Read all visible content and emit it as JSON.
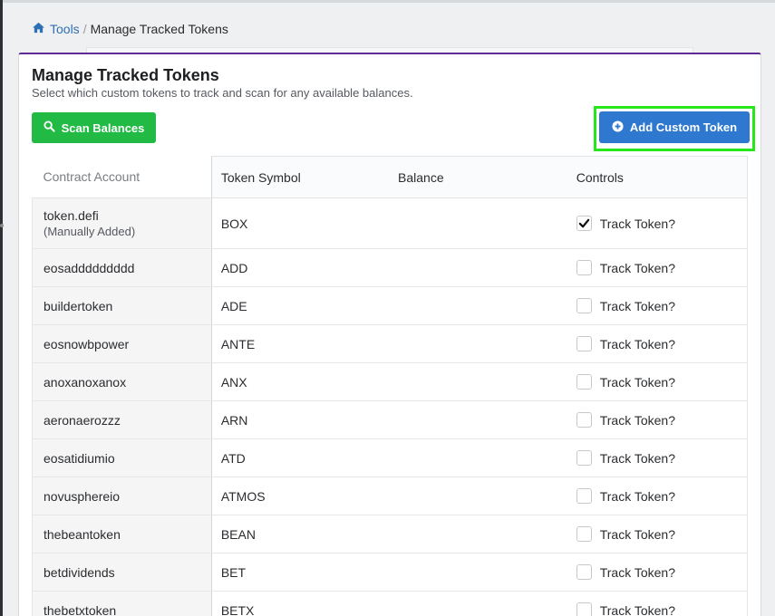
{
  "breadcrumb": {
    "parent": "Tools",
    "separator": "/",
    "current": "Manage Tracked Tokens",
    "link_color": "#2f6fb4"
  },
  "card": {
    "title": "Manage Tracked Tokens",
    "subtitle": "Select which custom tokens to track and scan for any available balances.",
    "accent_color": "#5e2b97"
  },
  "actions": {
    "scan_label": "Scan Balances",
    "scan_color": "#21ba45",
    "add_label": "Add Custom Token",
    "add_color": "#2e78d0",
    "highlight_color": "#26e61c"
  },
  "table": {
    "headers": {
      "contract": "Contract Account",
      "symbol": "Token Symbol",
      "balance": "Balance",
      "controls": "Controls"
    },
    "track_label": "Track Token?",
    "rows": [
      {
        "account": "token.defi",
        "note": "(Manually Added)",
        "symbol": "BOX",
        "balance": "",
        "tracked": true
      },
      {
        "account": "eosaddddddddd",
        "note": "",
        "symbol": "ADD",
        "balance": "",
        "tracked": false
      },
      {
        "account": "buildertoken",
        "note": "",
        "symbol": "ADE",
        "balance": "",
        "tracked": false
      },
      {
        "account": "eosnowbpower",
        "note": "",
        "symbol": "ANTE",
        "balance": "",
        "tracked": false
      },
      {
        "account": "anoxanoxanox",
        "note": "",
        "symbol": "ANX",
        "balance": "",
        "tracked": false
      },
      {
        "account": "aeronaerozzz",
        "note": "",
        "symbol": "ARN",
        "balance": "",
        "tracked": false
      },
      {
        "account": "eosatidiumio",
        "note": "",
        "symbol": "ATD",
        "balance": "",
        "tracked": false
      },
      {
        "account": "novusphereio",
        "note": "",
        "symbol": "ATMOS",
        "balance": "",
        "tracked": false
      },
      {
        "account": "thebeantoken",
        "note": "",
        "symbol": "BEAN",
        "balance": "",
        "tracked": false
      },
      {
        "account": "betdividends",
        "note": "",
        "symbol": "BET",
        "balance": "",
        "tracked": false
      },
      {
        "account": "thebetxtoken",
        "note": "",
        "symbol": "BETX",
        "balance": "",
        "tracked": false
      }
    ]
  },
  "icons": {
    "breadcrumb": "home-icon",
    "scan": "search-icon",
    "add": "plus-circle-icon",
    "checked": "checkmark-icon"
  }
}
